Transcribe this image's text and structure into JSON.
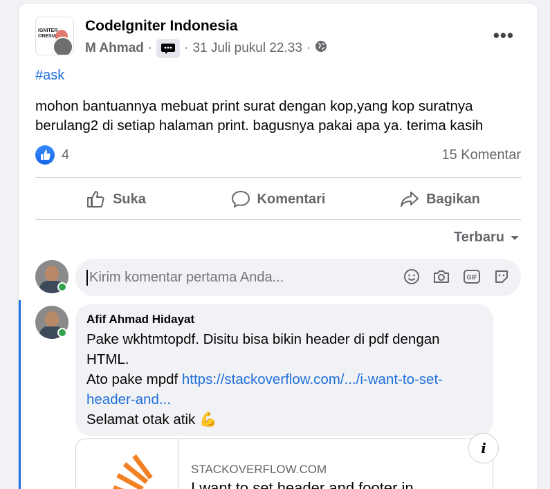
{
  "post": {
    "group_name": "CodeIgniter Indonesia",
    "group_logo_text": "IGNITER\nONESIA",
    "author": "M Ahmad",
    "separator": "·",
    "timestamp": "31 Juli pukul 22.33",
    "hashtag": "#ask",
    "body": "mohon bantuannya mebuat print surat dengan kop,yang kop suratnya berulang2 di setiap halaman print. bagusnya pakai apa ya. terima kasih",
    "reaction_count": "4",
    "comment_count": "15 Komentar",
    "more_icon": "more-horizontal-icon",
    "privacy_icon": "globe-icon",
    "badge_icon": "conversation-starter-icon"
  },
  "actions": {
    "like": "Suka",
    "comment": "Komentari",
    "share": "Bagikan"
  },
  "sort": {
    "label": "Terbaru"
  },
  "composer": {
    "placeholder": "Kirim komentar pertama Anda...",
    "icons": [
      "emoji-icon",
      "camera-icon",
      "gif-icon",
      "sticker-icon"
    ]
  },
  "comment": {
    "author": "Afif Ahmad Hidayat",
    "line1": "Pake wkhtmtopdf. Disitu bisa bikin header di pdf dengan HTML.",
    "line2_prefix": "Ato pake mpdf ",
    "link": "https://stackoverflow.com/.../i-want-to-set-header-and...",
    "line3": "Selamat otak atik 💪"
  },
  "link_preview": {
    "domain": "STACKOVERFLOW.COM",
    "title": "I want to set header and footer in",
    "info": "i"
  },
  "colors": {
    "accent": "#216fdb",
    "like_blue": "#1b74e4",
    "muted": "#65676b",
    "online": "#31a24c",
    "stackoverflow_orange": "#f48024"
  }
}
